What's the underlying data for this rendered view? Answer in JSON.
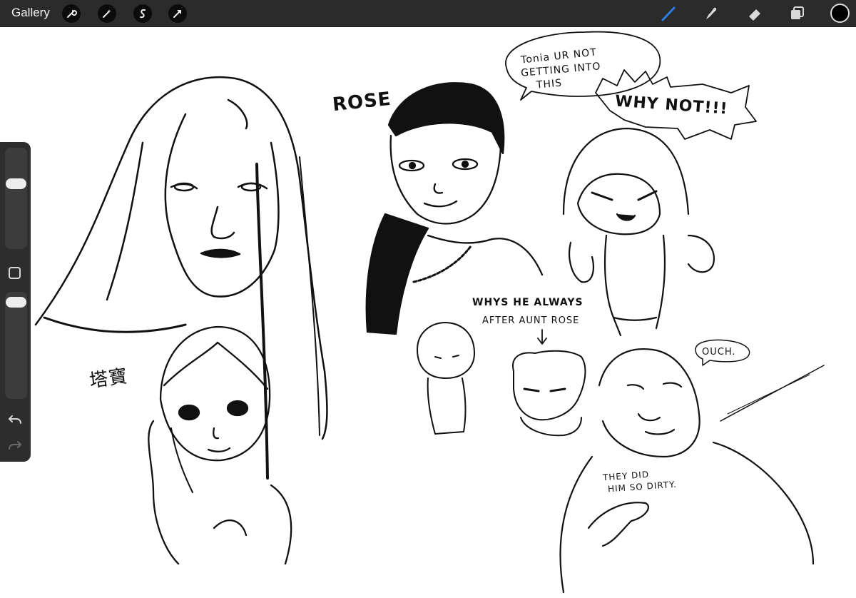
{
  "toolbar": {
    "gallery_label": "Gallery",
    "left_tools": [
      "wrench-icon",
      "magic-wand-icon",
      "selection-icon",
      "transform-arrow-icon"
    ],
    "right_tools": [
      "brush-icon",
      "smudge-icon",
      "eraser-icon",
      "layers-icon"
    ],
    "active_tool": "brush",
    "accent_color": "#2f7de1",
    "current_color": "#000000"
  },
  "sidebar": {
    "brush_size_level": 0.9,
    "opacity_level": 0.95,
    "controls": [
      "brush-size-slider",
      "modify-button",
      "opacity-slider",
      "undo-icon",
      "redo-icon"
    ]
  },
  "canvas": {
    "labels": {
      "rose": "ROSE",
      "chinese_name": "塔寶",
      "bubble_line1": "Tonia UR NOT",
      "bubble_line2": "GETTING INTO",
      "bubble_line3": "THIS",
      "why_not": "WHY NOT!!!",
      "whys_line1": "WHYS HE ALWAYS",
      "whys_line2": "AFTER AUNT ROSE",
      "ouch": "OUCH.",
      "dirty_line1": "THEY DID",
      "dirty_line2": "HIM SO DIRTY."
    }
  }
}
